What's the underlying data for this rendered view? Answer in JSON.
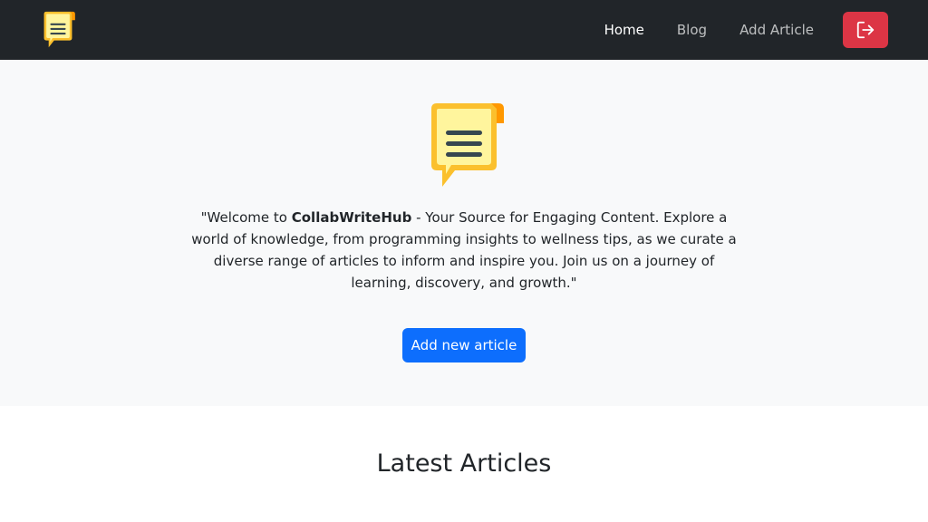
{
  "navbar": {
    "brand_icon": "document-chat-icon",
    "links": [
      {
        "label": "Home",
        "active": true
      },
      {
        "label": "Blog",
        "active": false
      },
      {
        "label": "Add Article",
        "active": false
      }
    ],
    "logout_icon": "logout-icon",
    "logout_color": "#dc3545"
  },
  "hero": {
    "logo_icon": "document-chat-icon",
    "text_before": "\"Welcome to ",
    "brand_name": "CollabWriteHub",
    "text_after": " - Your Source for Engaging Content. Explore a world of knowledge, from programming insights to wellness tips, as we curate a diverse range of articles to inform and inspire you. Join us on a journey of learning, discovery, and growth.\"",
    "button_label": "Add new article",
    "button_color": "#0d6efd"
  },
  "latest": {
    "title": "Latest Articles"
  }
}
